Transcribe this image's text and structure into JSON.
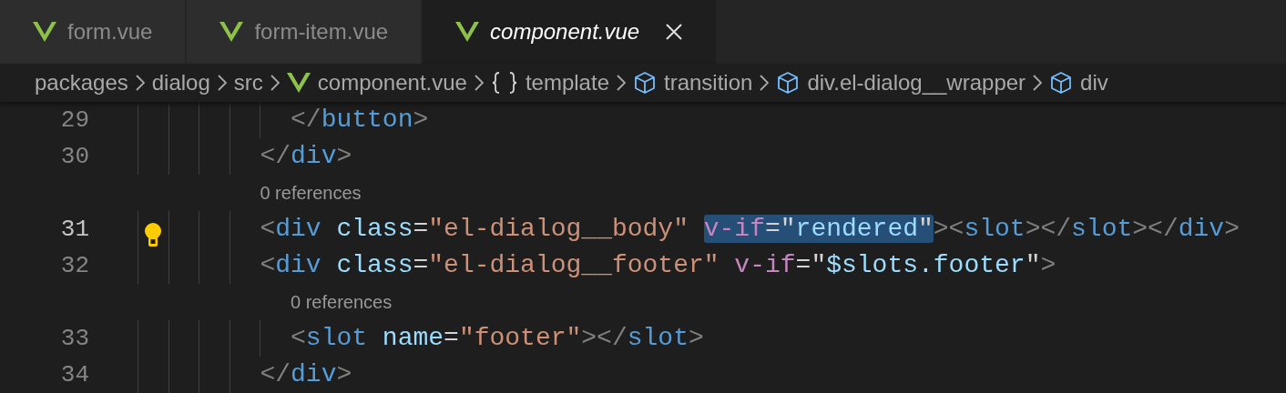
{
  "tabs": [
    {
      "label": "form.vue",
      "selected": false,
      "preview": false
    },
    {
      "label": "form-item.vue",
      "selected": false,
      "preview": false
    },
    {
      "label": "component.vue",
      "selected": true,
      "preview": true
    }
  ],
  "breadcrumbs": [
    {
      "label": "packages",
      "kind": "folder"
    },
    {
      "label": "dialog",
      "kind": "folder"
    },
    {
      "label": "src",
      "kind": "folder"
    },
    {
      "label": "component.vue",
      "kind": "vue"
    },
    {
      "label": "template",
      "kind": "braces"
    },
    {
      "label": "transition",
      "kind": "element"
    },
    {
      "label": "div.el-dialog__wrapper",
      "kind": "element"
    },
    {
      "label": "div",
      "kind": "element"
    }
  ],
  "lines": [
    {
      "kind": "code",
      "number": "29",
      "current": false,
      "tokens": [
        {
          "t": "          </",
          "kind": "punct",
          "highlighted": false
        },
        {
          "t": "button",
          "kind": "tag",
          "highlighted": false
        },
        {
          "t": ">",
          "kind": "punct",
          "highlighted": false
        }
      ]
    },
    {
      "kind": "code",
      "number": "30",
      "current": false,
      "tokens": [
        {
          "t": "        </",
          "kind": "punct",
          "highlighted": false
        },
        {
          "t": "div",
          "kind": "tag",
          "highlighted": false
        },
        {
          "t": ">",
          "kind": "punct",
          "highlighted": false
        }
      ]
    },
    {
      "kind": "codelens",
      "text": "        0 references"
    },
    {
      "kind": "code",
      "number": "31",
      "current": true,
      "lightbulb": true,
      "tokens": [
        {
          "t": "        <",
          "kind": "punct",
          "highlighted": false
        },
        {
          "t": "div",
          "kind": "tag",
          "highlighted": false
        },
        {
          "t": " class",
          "kind": "attr",
          "highlighted": false
        },
        {
          "t": "=",
          "kind": "plain",
          "highlighted": false
        },
        {
          "t": "\"el-dialog__body\" ",
          "kind": "string",
          "highlighted": false
        },
        {
          "t": "v-if",
          "kind": "directive",
          "highlighted": true
        },
        {
          "t": "=\"",
          "kind": "plain",
          "highlighted": true
        },
        {
          "t": "rendered",
          "kind": "expr",
          "highlighted": true
        },
        {
          "t": "\"",
          "kind": "plain",
          "highlighted": true
        },
        {
          "t": "><",
          "kind": "punct",
          "highlighted": false
        },
        {
          "t": "slot",
          "kind": "tag",
          "highlighted": false
        },
        {
          "t": "></",
          "kind": "punct",
          "highlighted": false
        },
        {
          "t": "slot",
          "kind": "tag",
          "highlighted": false
        },
        {
          "t": "></",
          "kind": "punct",
          "highlighted": false
        },
        {
          "t": "div",
          "kind": "tag",
          "highlighted": false
        },
        {
          "t": ">",
          "kind": "punct",
          "highlighted": false
        }
      ]
    },
    {
      "kind": "code",
      "number": "32",
      "current": false,
      "tokens": [
        {
          "t": "        <",
          "kind": "punct",
          "highlighted": false
        },
        {
          "t": "div",
          "kind": "tag",
          "highlighted": false
        },
        {
          "t": " class",
          "kind": "attr",
          "highlighted": false
        },
        {
          "t": "=",
          "kind": "plain",
          "highlighted": false
        },
        {
          "t": "\"el-dialog__footer\" ",
          "kind": "string",
          "highlighted": false
        },
        {
          "t": "v-if",
          "kind": "directive",
          "highlighted": false
        },
        {
          "t": "=\"",
          "kind": "plain",
          "highlighted": false
        },
        {
          "t": "$slots.footer",
          "kind": "expr",
          "highlighted": false
        },
        {
          "t": "\"",
          "kind": "plain",
          "highlighted": false
        },
        {
          "t": ">",
          "kind": "punct",
          "highlighted": false
        }
      ]
    },
    {
      "kind": "codelens",
      "text": "          0 references"
    },
    {
      "kind": "code",
      "number": "33",
      "current": false,
      "tokens": [
        {
          "t": "          <",
          "kind": "punct",
          "highlighted": false
        },
        {
          "t": "slot",
          "kind": "tag",
          "highlighted": false
        },
        {
          "t": " name",
          "kind": "attr",
          "highlighted": false
        },
        {
          "t": "=",
          "kind": "plain",
          "highlighted": false
        },
        {
          "t": "\"footer\"",
          "kind": "string",
          "highlighted": false
        },
        {
          "t": "></",
          "kind": "punct",
          "highlighted": false
        },
        {
          "t": "slot",
          "kind": "tag",
          "highlighted": false
        },
        {
          "t": ">",
          "kind": "punct",
          "highlighted": false
        }
      ]
    },
    {
      "kind": "code",
      "number": "34",
      "current": false,
      "tokens": [
        {
          "t": "        </",
          "kind": "punct",
          "highlighted": false
        },
        {
          "t": "div",
          "kind": "tag",
          "highlighted": false
        },
        {
          "t": ">",
          "kind": "punct",
          "highlighted": false
        }
      ]
    }
  ]
}
